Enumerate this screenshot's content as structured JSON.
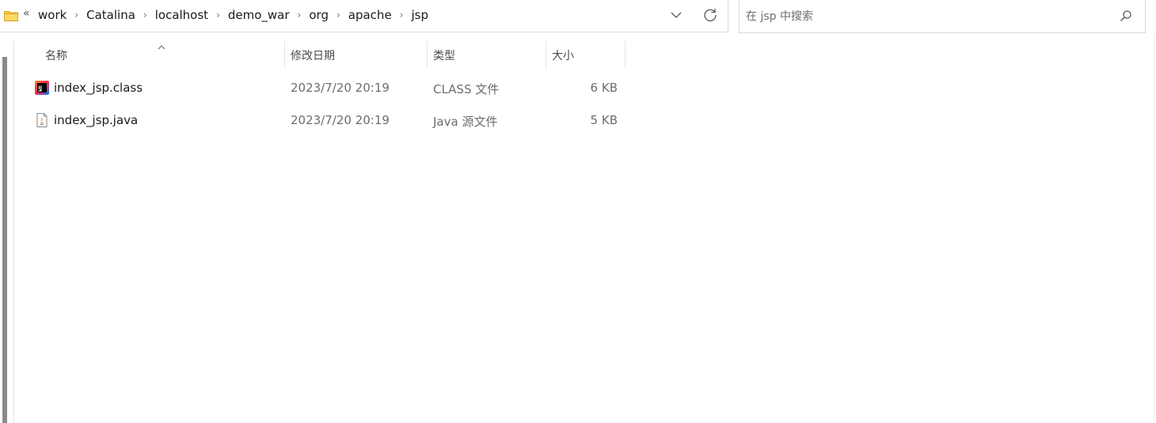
{
  "address_bar": {
    "overflow": "«",
    "crumbs": [
      "work",
      "Catalina",
      "localhost",
      "demo_war",
      "org",
      "apache",
      "jsp"
    ]
  },
  "search": {
    "placeholder": "在 jsp 中搜索"
  },
  "columns": {
    "name": "名称",
    "date": "修改日期",
    "type": "类型",
    "size": "大小"
  },
  "files": [
    {
      "name": "index_jsp.class",
      "date": "2023/7/20 20:19",
      "type": "CLASS 文件",
      "size": "6 KB",
      "icon": "intellij-class-icon"
    },
    {
      "name": "index_jsp.java",
      "date": "2023/7/20 20:19",
      "type": "Java 源文件",
      "size": "5 KB",
      "icon": "java-file-icon"
    }
  ],
  "colors": {
    "folder": "#f7c948",
    "border": "#d9d9d9",
    "muted_text": "#6d6d6d"
  }
}
